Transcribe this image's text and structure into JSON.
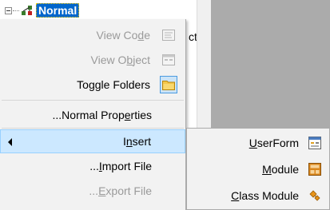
{
  "tree": {
    "project_label": "Normal",
    "partial_text": "cts"
  },
  "menu": {
    "items": [
      {
        "label": "View Code",
        "accel": "d",
        "enabled": false,
        "icon": "code-window-icon"
      },
      {
        "label": "View Object",
        "accel": "b",
        "enabled": false,
        "icon": "form-object-icon"
      },
      {
        "label": "Toggle Folders",
        "enabled": true,
        "icon": "folder-icon"
      },
      {
        "label": "...Normal Properties",
        "accel": "e",
        "enabled": true
      },
      {
        "label": "Insert",
        "accel": "n",
        "enabled": true,
        "highlighted": true,
        "submenu": true
      },
      {
        "label": "...Import File",
        "accel": "I",
        "enabled": true
      },
      {
        "label": "...Export File",
        "accel": "E",
        "enabled": false
      }
    ]
  },
  "submenu": {
    "items": [
      {
        "label": "UserForm",
        "accel": "U",
        "icon": "userform-icon"
      },
      {
        "label": "Module",
        "accel": "M",
        "icon": "module-icon"
      },
      {
        "label": "Class Module",
        "accel": "C",
        "icon": "class-module-icon"
      }
    ]
  },
  "colors": {
    "menu_bg": "#f2f2f2",
    "highlight_bg": "#cce8ff",
    "highlight_border": "#99d1ff",
    "disabled_text": "#9a9a9a",
    "selection_bg": "#0066cc",
    "right_pane_bg": "#ababab"
  }
}
